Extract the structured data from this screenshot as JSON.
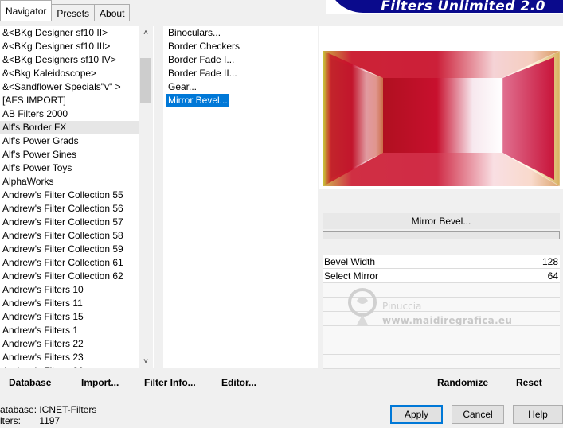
{
  "tabs": [
    {
      "label": "Navigator",
      "active": true
    },
    {
      "label": "Presets",
      "active": false
    },
    {
      "label": "About",
      "active": false
    }
  ],
  "banner": {
    "title": "Filters Unlimited 2.0"
  },
  "categories": [
    "&<BKg Designer sf10 II>",
    "&<BKg Designer sf10 III>",
    "&<BKg Designers sf10 IV>",
    "&<Bkg Kaleidoscope>",
    "&<Sandflower Specials\"v\" >",
    "[AFS IMPORT]",
    "AB Filters 2000",
    "Alf's Border FX",
    "Alf's Power Grads",
    "Alf's Power Sines",
    "Alf's Power Toys",
    "AlphaWorks",
    "Andrew's Filter Collection 55",
    "Andrew's Filter Collection 56",
    "Andrew's Filter Collection 57",
    "Andrew's Filter Collection 58",
    "Andrew's Filter Collection 59",
    "Andrew's Filter Collection 61",
    "Andrew's Filter Collection 62",
    "Andrew's Filters 10",
    "Andrew's Filters 11",
    "Andrew's Filters 15",
    "Andrew's Filters 1",
    "Andrew's Filters 22",
    "Andrew's Filters 23",
    "Andrew's Filters 26"
  ],
  "selected_category": "Alf's Border FX",
  "filters": [
    "Binoculars...",
    "Border Checkers",
    "Border Fade I...",
    "Border Fade II...",
    "Gear...",
    "Mirror Bevel..."
  ],
  "selected_filter": "Mirror Bevel...",
  "filter_name": "Mirror Bevel...",
  "controls": [
    {
      "label": "Bevel Width",
      "value": "128"
    },
    {
      "label": "Select Mirror",
      "value": "64"
    }
  ],
  "watermark": {
    "line1": "Pinuccia",
    "line2": "www.maidiregrafica.eu"
  },
  "toolbar": {
    "database": "Database",
    "import": "Import...",
    "filter_info": "Filter Info...",
    "editor": "Editor...",
    "randomize": "Randomize",
    "reset": "Reset"
  },
  "status": {
    "database_label": "atabase:",
    "database_value": "ICNET-Filters",
    "filters_label": "lters:",
    "filters_value": "1197"
  },
  "buttons": {
    "apply": "Apply",
    "cancel": "Cancel",
    "help": "Help"
  },
  "colors": {
    "selection": "#0078d7",
    "banner": "#0a0a8c"
  }
}
